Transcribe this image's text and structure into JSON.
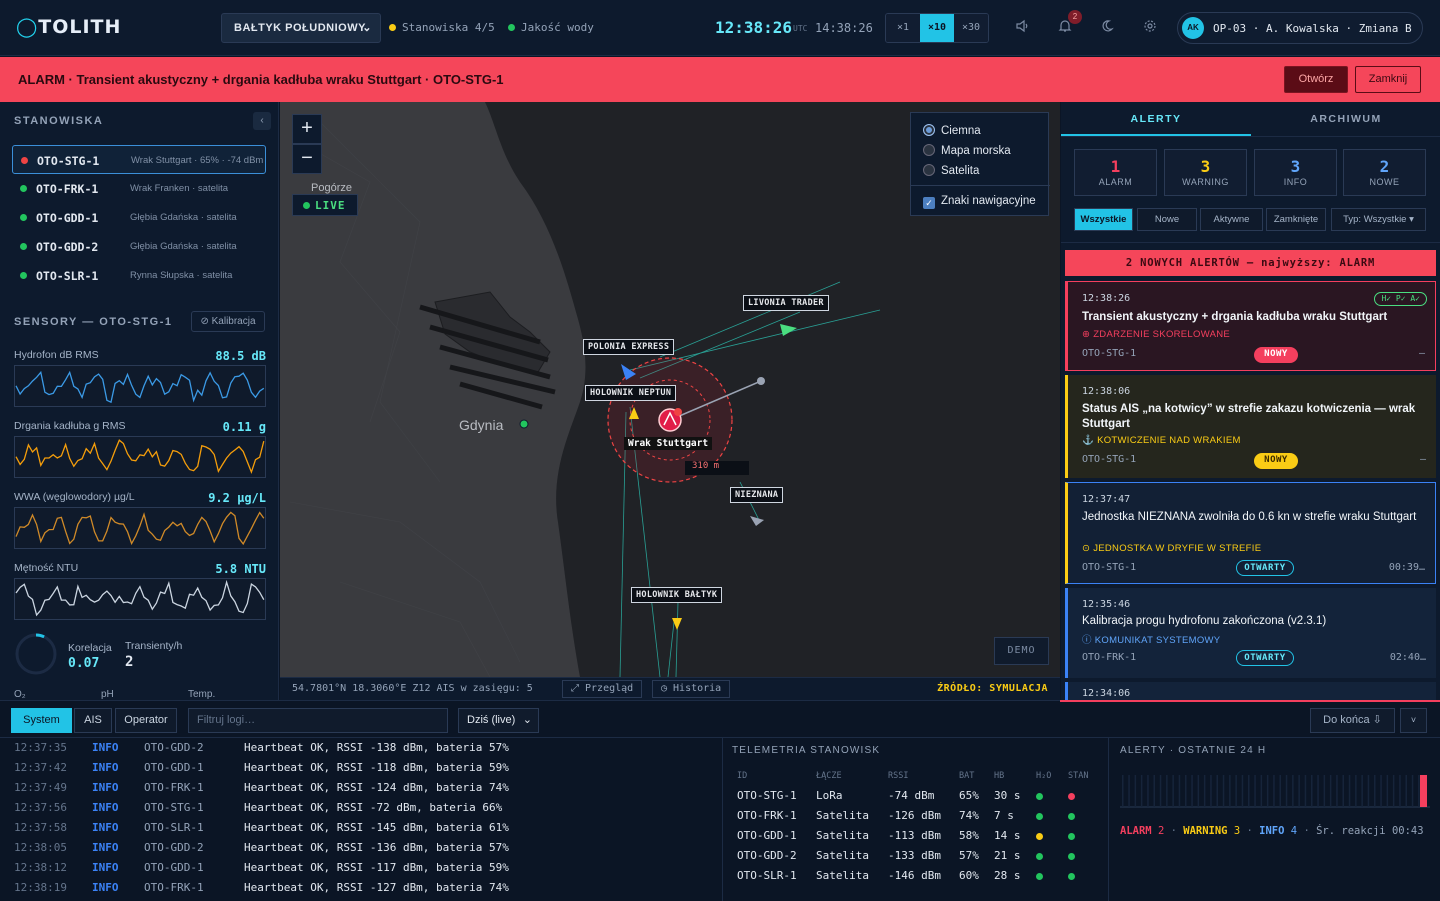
{
  "app": {
    "title": "OTOLITH"
  },
  "header": {
    "region": "BAŁTYK POŁUDNIOWY",
    "stations_status": "Stanowiska 4/5",
    "water_status": "Jakość wody",
    "clock": "12:38:26",
    "clock_zone": "UTC",
    "local_time": "14:38:26",
    "speeds": [
      "×1",
      "×10",
      "×30"
    ],
    "active_speed": "×10",
    "notifications_count": "2",
    "user": {
      "initials": "AK",
      "label": "OP-03 · A. Kowalska · Zmiana B"
    }
  },
  "alarm_bar": {
    "text": "ALARM · Transient akustyczny + drgania kadłuba wraku Stuttgart · OTO-STG-1",
    "open_label": "Otwórz",
    "close_label": "Zamknij"
  },
  "stations_panel": {
    "title": "STANOWISKA",
    "collapse_icon": "‹",
    "items": [
      {
        "id": "OTO-STG-1",
        "desc": "Wrak Stuttgart · 65% · -74 dBm",
        "status_color": "#ef4444",
        "selected": true
      },
      {
        "id": "OTO-FRK-1",
        "desc": "Wrak Franken · satelita",
        "status_color": "#22c55e"
      },
      {
        "id": "OTO-GDD-1",
        "desc": "Głębia Gdańska · satelita",
        "status_color": "#22c55e"
      },
      {
        "id": "OTO-GDD-2",
        "desc": "Głębia Gdańska · satelita",
        "status_color": "#22c55e"
      },
      {
        "id": "OTO-SLR-1",
        "desc": "Rynna Słupska · satelita",
        "status_color": "#22c55e"
      }
    ]
  },
  "sensors_panel": {
    "title": "SENSORY — OTO-STG-1",
    "calibration_label": "⊘ Kalibracja",
    "sensors": [
      {
        "name": "Hydrofon dB RMS",
        "value": "88.5 dB",
        "color": "#3b9ae6"
      },
      {
        "name": "Drgania kadłuba g RMS",
        "value": "0.11 g",
        "color": "#f59e0b"
      },
      {
        "name": "WWA (węglowodory) µg/L",
        "value": "9.2 µg/L",
        "color": "#d08a28"
      },
      {
        "name": "Mętność NTU",
        "value": "5.8 NTU",
        "color": "#cbd5e1"
      }
    ],
    "correlation_label": "Korelacja",
    "correlation_value": "0.07",
    "transients_label": "Transienty/h",
    "transients_value": "2",
    "bottom_labels": [
      "O₂",
      "pH",
      "Temp."
    ]
  },
  "map": {
    "zoom_in": "+",
    "zoom_out": "−",
    "live_label": "LIVE",
    "place_labels": {
      "city": "Gdynia",
      "district": "Pogórze"
    },
    "layers": [
      "Ciemna",
      "Mapa morska",
      "Satelita"
    ],
    "active_layer": "Ciemna",
    "nav_marks_label": "Znaki nawigacyjne",
    "vessels": [
      "POLONIA EXPRESS",
      "LIVONIA TRADER",
      "HOLOWNIK NEPTUN",
      "NIEZNANA",
      "HOLOWNIK BAŁTYK"
    ],
    "wreck_label": "Wrak Stuttgart",
    "range_label": "310 m",
    "demo_label": "DEMO",
    "coords": "54.7801°N 18.3060°E  Z12  AIS w zasięgu: 5",
    "overview_label": "⤢ Przegląd",
    "history_label": "◷ Historia",
    "source_label": "ŹRÓDŁO: SYMULACJA"
  },
  "alerts_panel": {
    "tabs": [
      "ALERTY",
      "ARCHIWUM"
    ],
    "counters": [
      {
        "n": "1",
        "label": "ALARM",
        "color": "#f43f5e"
      },
      {
        "n": "3",
        "label": "WARNING",
        "color": "#facc15"
      },
      {
        "n": "3",
        "label": "INFO",
        "color": "#60a5fa"
      },
      {
        "n": "2",
        "label": "NOWE",
        "color": "#60a5fa"
      }
    ],
    "filters": [
      "Wszystkie",
      "Nowe",
      "Aktywne",
      "Zamknięte",
      "Typ: Wszystkie ▾"
    ],
    "new_bar": "2 NOWYCH ALERTÓW — najwyższy: ALARM",
    "cards": [
      {
        "time": "12:38:26",
        "badges": "H✓ P✓ A✓",
        "title": "Transient akustyczny + drgania kadłuba wraku Stuttgart",
        "category": "⊕ ZDARZENIE SKORELOWANE",
        "station": "OTO-STG-1",
        "status": "NOWY",
        "elapsed": "—"
      },
      {
        "time": "12:38:06",
        "title": "Status AIS „na kotwicy” w strefie zakazu kotwiczenia — wrak Stuttgart",
        "category": "⚓ KOTWICZENIE NAD WRAKIEM",
        "station": "OTO-STG-1",
        "status": "NOWY",
        "elapsed": "—"
      },
      {
        "time": "12:37:47",
        "title": "Jednostka NIEZNANA zwolniła do 0.6 kn w strefie wraku Stuttgart",
        "category": "⊙ JEDNOSTKA W DRYFIE W STREFIE",
        "station": "OTO-STG-1",
        "status": "OTWARTY",
        "elapsed": "00:39…"
      },
      {
        "time": "12:35:46",
        "title": "Kalibracja progu hydrofonu zakończona (v2.3.1)",
        "category": "ⓘ KOMUNIKAT SYSTEMOWY",
        "station": "OTO-FRK-1",
        "status": "OTWARTY",
        "elapsed": "02:40…"
      },
      {
        "time": "12:34:06"
      }
    ]
  },
  "log_panel": {
    "tabs": [
      "System",
      "AIS",
      "Operator"
    ],
    "filter_placeholder": "Filtruj logi…",
    "day_select": "Dziś (live)",
    "to_end": "Do końca ⇩",
    "more": "˅",
    "rows": [
      {
        "time": "12:37:35",
        "level": "INFO",
        "src": "OTO-GDD-2",
        "msg": "Heartbeat OK, RSSI -138 dBm, bateria 57%"
      },
      {
        "time": "12:37:42",
        "level": "INFO",
        "src": "OTO-GDD-1",
        "msg": "Heartbeat OK, RSSI -118 dBm, bateria 59%"
      },
      {
        "time": "12:37:49",
        "level": "INFO",
        "src": "OTO-FRK-1",
        "msg": "Heartbeat OK, RSSI -124 dBm, bateria 74%"
      },
      {
        "time": "12:37:56",
        "level": "INFO",
        "src": "OTO-STG-1",
        "msg": "Heartbeat OK, RSSI -72 dBm, bateria 66%"
      },
      {
        "time": "12:37:58",
        "level": "INFO",
        "src": "OTO-SLR-1",
        "msg": "Heartbeat OK, RSSI -145 dBm, bateria 61%"
      },
      {
        "time": "12:38:05",
        "level": "INFO",
        "src": "OTO-GDD-2",
        "msg": "Heartbeat OK, RSSI -136 dBm, bateria 57%"
      },
      {
        "time": "12:38:12",
        "level": "INFO",
        "src": "OTO-GDD-1",
        "msg": "Heartbeat OK, RSSI -117 dBm, bateria 59%"
      },
      {
        "time": "12:38:19",
        "level": "INFO",
        "src": "OTO-FRK-1",
        "msg": "Heartbeat OK, RSSI -127 dBm, bateria 74%"
      }
    ]
  },
  "telemetry": {
    "title": "TELEMETRIA STANOWISK",
    "columns": [
      "ID",
      "ŁĄCZE",
      "RSSI",
      "BAT",
      "HB",
      "H₂O",
      "STAN"
    ],
    "rows": [
      {
        "id": "OTO-STG-1",
        "link": "LoRa",
        "rssi": "-74 dBm",
        "bat": "65%",
        "hb": "30 s",
        "h2o": "#22c55e",
        "state": "#f43f5e"
      },
      {
        "id": "OTO-FRK-1",
        "link": "Satelita",
        "rssi": "-126 dBm",
        "bat": "74%",
        "hb": "7 s",
        "h2o": "#22c55e",
        "state": "#22c55e"
      },
      {
        "id": "OTO-GDD-1",
        "link": "Satelita",
        "rssi": "-113 dBm",
        "bat": "58%",
        "hb": "14 s",
        "h2o": "#facc15",
        "state": "#22c55e"
      },
      {
        "id": "OTO-GDD-2",
        "link": "Satelita",
        "rssi": "-133 dBm",
        "bat": "57%",
        "hb": "21 s",
        "h2o": "#22c55e",
        "state": "#22c55e"
      },
      {
        "id": "OTO-SLR-1",
        "link": "Satelita",
        "rssi": "-146 dBm",
        "bat": "60%",
        "hb": "28 s",
        "h2o": "#22c55e",
        "state": "#22c55e"
      }
    ]
  },
  "alerts_24h": {
    "title": "ALERTY · OSTATNIE 24 H",
    "alarm_label": "ALARM",
    "alarm_count": "2",
    "warning_label": "WARNING",
    "warning_count": "3",
    "info_label": "INFO",
    "info_count": "4",
    "reaction": "Śr. reakcji 00:43"
  }
}
